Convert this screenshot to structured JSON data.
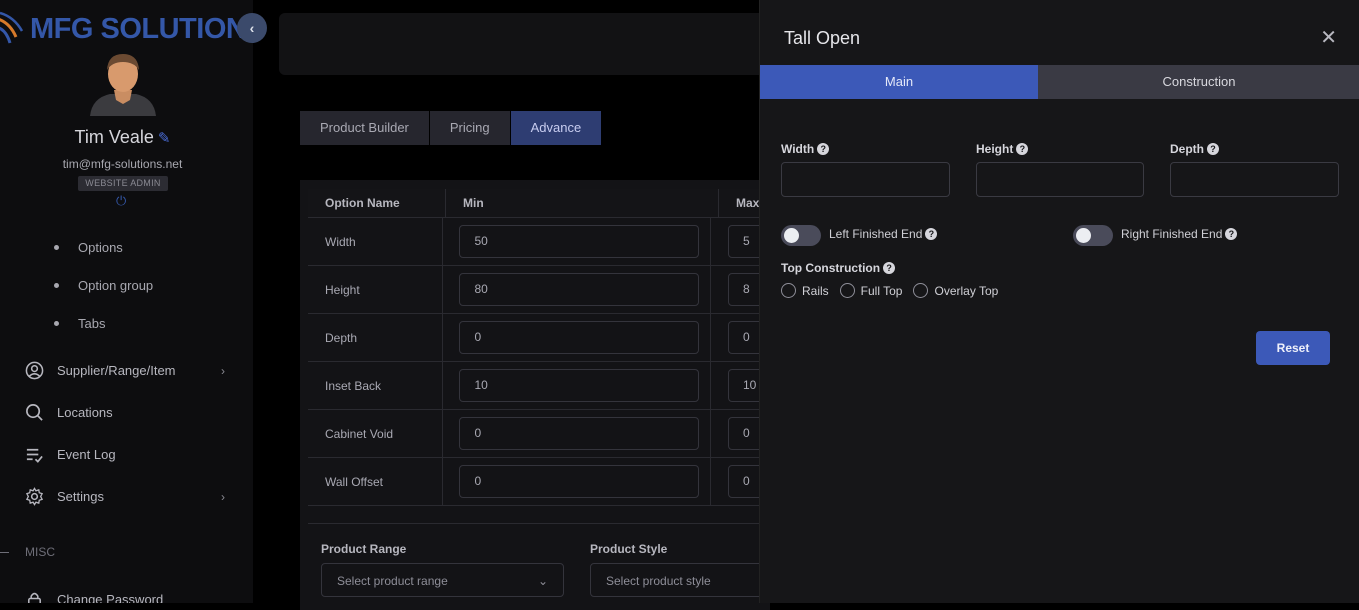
{
  "brand": {
    "name": "MFG SOLUTION"
  },
  "user": {
    "name": "Tim Veale",
    "email": "tim@mfg-solutions.net",
    "role": "WEBSITE ADMIN"
  },
  "sidebar": {
    "sub_items": [
      {
        "label": "Options"
      },
      {
        "label": "Option group"
      },
      {
        "label": "Tabs"
      }
    ],
    "nav_items": [
      {
        "label": "Supplier/Range/Item",
        "icon": "user-circle-icon",
        "has_chevron": true
      },
      {
        "label": "Locations",
        "icon": "search-icon",
        "has_chevron": false
      },
      {
        "label": "Event Log",
        "icon": "list-check-icon",
        "has_chevron": false
      },
      {
        "label": "Settings",
        "icon": "gear-icon",
        "has_chevron": true
      }
    ],
    "section_label": "MISC",
    "bottom_item": {
      "label": "Change Password",
      "icon": "lock-icon"
    }
  },
  "main": {
    "tabs": [
      {
        "label": "Product Builder",
        "active": false
      },
      {
        "label": "Pricing",
        "active": false
      },
      {
        "label": "Advance",
        "active": true
      }
    ],
    "table": {
      "headers": [
        "Option Name",
        "Min",
        "Max"
      ],
      "rows": [
        {
          "name": "Width",
          "min": "50",
          "max": "5"
        },
        {
          "name": "Height",
          "min": "80",
          "max": "8"
        },
        {
          "name": "Depth",
          "min": "0",
          "max": "0"
        },
        {
          "name": "Inset Back",
          "min": "10",
          "max": "10"
        },
        {
          "name": "Cabinet Void",
          "min": "0",
          "max": "0"
        },
        {
          "name": "Wall Offset",
          "min": "0",
          "max": "0"
        }
      ]
    },
    "product_range": {
      "label": "Product Range",
      "placeholder": "Select product range"
    },
    "product_style": {
      "label": "Product Style",
      "placeholder": "Select product style"
    }
  },
  "drawer": {
    "title": "Tall Open",
    "close_icon": "close-icon",
    "tabs": [
      {
        "label": "Main",
        "active": true
      },
      {
        "label": "Construction",
        "active": false
      }
    ],
    "fields": [
      {
        "label": "Width",
        "value": ""
      },
      {
        "label": "Height",
        "value": ""
      },
      {
        "label": "Depth",
        "value": ""
      }
    ],
    "toggles": [
      {
        "label": "Left Finished End",
        "on": false
      },
      {
        "label": "Right Finished End",
        "on": false
      }
    ],
    "top_construction": {
      "label": "Top Construction",
      "options": [
        "Rails",
        "Full Top",
        "Overlay Top"
      ]
    },
    "reset_label": "Reset"
  },
  "colors": {
    "accent": "#3c59b8",
    "brand": "#3457a8",
    "drawer_bg": "#161618"
  }
}
